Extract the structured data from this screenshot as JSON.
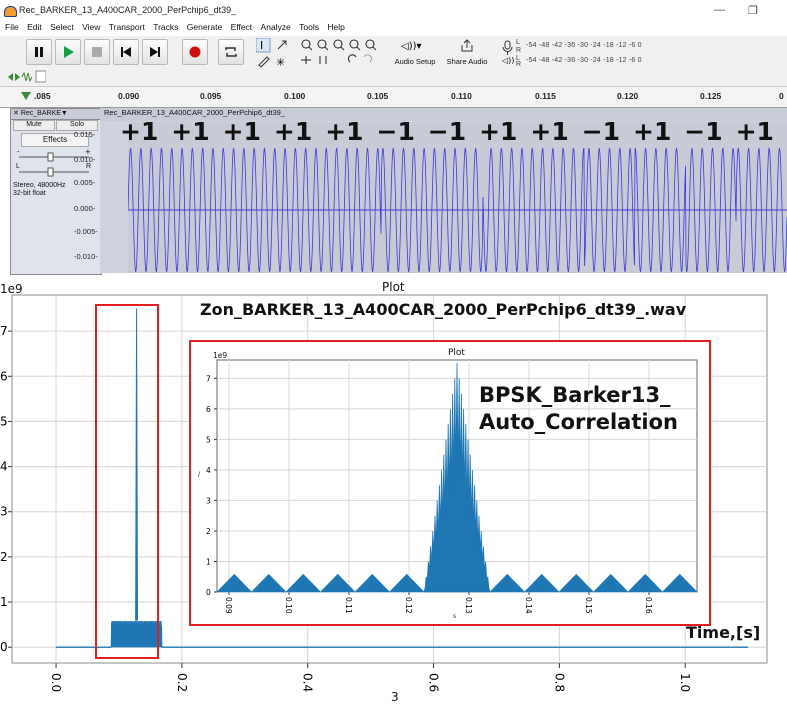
{
  "window": {
    "title": "Rec_BARKER_13_A400CAR_2000_PerPchip6_dt39_",
    "minimize_glyph": "—",
    "restore_glyph": "❐"
  },
  "menu": [
    "File",
    "Edit",
    "Select",
    "View",
    "Transport",
    "Tracks",
    "Generate",
    "Effect",
    "Analyze",
    "Tools",
    "Help"
  ],
  "toolbar": {
    "audio_setup_label": "Audio Setup",
    "share_audio_label": "Share Audio",
    "meter_scale": "-54 -48 -42 -36 -30 -24 -18 -12 -6 0",
    "meter_scale_2": "-54 -48 -42 -36 -30 -24 -18 -12 -6 0",
    "meter_L": "L",
    "meter_R": "R",
    "vol_icon": "speaker-icon"
  },
  "ruler": {
    "labels": [
      ".085",
      "0.090",
      "0.095",
      "0.100",
      "0.105",
      "0.110",
      "0.115",
      "0.120",
      "0.125",
      "0"
    ]
  },
  "track": {
    "name": "Rec_BARKE▼",
    "clip_name": "Rec_BARKER_13_A400CAR_2000_PerPchip6_dt39_",
    "mute": "Mute",
    "solo": "Solo",
    "effects": "Effects",
    "pan_L": "L",
    "pan_R": "R",
    "info_line1": "Stereo, 48000Hz",
    "info_line2": "32-bit float",
    "yticks": [
      "0.015-",
      "0.010-",
      "0.005-",
      "0.000-",
      "-0.005-",
      "-0.010-"
    ],
    "chips": [
      "+1",
      "+1",
      "+1",
      "+1",
      "+1",
      "−1",
      "−1",
      "+1",
      "+1",
      "−1",
      "+1",
      "−1",
      "+1"
    ]
  },
  "plot": {
    "window_title": "Plot",
    "exponent": "1e9",
    "title": "Zon_BARKER_13_A400CAR_2000_PerPchip6_dt39_.wav",
    "ytick_labels": [
      "7",
      "6",
      "5",
      "4",
      "3",
      "2",
      "1",
      "0"
    ],
    "xtick_labels": [
      "0.0",
      "0.2",
      "0.4",
      "0.6",
      "0.8",
      "1.0"
    ],
    "xlabel": "Time,[s]",
    "bottom_label": "3",
    "highlight_color": "#e02020",
    "line_color": "#1f77b4"
  },
  "inset": {
    "window_title": "Plot",
    "exponent": "1e9",
    "annotation_line1": "BPSK_Barker13_",
    "annotation_line2": "Auto_Correlation",
    "ytick_labels": [
      "7",
      "6",
      "5",
      "4",
      "3",
      "2",
      "1",
      "0"
    ],
    "xtick_labels": [
      "0.09",
      "0.10",
      "0.11",
      "0.12",
      "0.13",
      "0.14",
      "0.15",
      "0.16"
    ],
    "ylabel_fragment": "/",
    "xlabel_fragment": "s"
  },
  "chart_data": [
    {
      "type": "line",
      "title": "Zon_BARKER_13_A400CAR_2000_PerPchip6_dt39_.wav",
      "xlabel": "Time,[s]",
      "ylabel": "",
      "xlim": [
        -0.07,
        1.13
      ],
      "ylim": [
        -0.35,
        7.8
      ],
      "y_exponent": "1e9",
      "x_ticks": [
        0.0,
        0.2,
        0.4,
        0.6,
        0.8,
        1.0
      ],
      "y_ticks": [
        0,
        1,
        2,
        3,
        4,
        5,
        6,
        7
      ],
      "grid": true,
      "series": [
        {
          "x": [
            0.0,
            0.088,
            0.093,
            0.098,
            0.103,
            0.108,
            0.113,
            0.118,
            0.123,
            0.128,
            0.133,
            0.138,
            0.143,
            0.148,
            0.153,
            0.158,
            0.168,
            1.1
          ],
          "y": [
            0.0,
            0.0,
            0.58,
            0.58,
            0.58,
            0.58,
            0.58,
            0.58,
            0.58,
            7.5,
            0.58,
            0.58,
            0.58,
            0.58,
            0.58,
            0.58,
            0.0,
            0.0
          ]
        }
      ]
    },
    {
      "type": "line",
      "title": "Plot",
      "xlabel": "",
      "ylabel": "",
      "xlim": [
        0.088,
        0.168
      ],
      "ylim": [
        0,
        7.6
      ],
      "y_exponent": "1e9",
      "x_ticks": [
        0.09,
        0.1,
        0.11,
        0.12,
        0.13,
        0.14,
        0.15,
        0.16
      ],
      "y_ticks": [
        0,
        1,
        2,
        3,
        4,
        5,
        6,
        7
      ],
      "grid": true,
      "peak": {
        "x": 0.128,
        "y": 7.5
      },
      "sidelobe_level": 0.58,
      "sidelobe_count": 12
    }
  ]
}
